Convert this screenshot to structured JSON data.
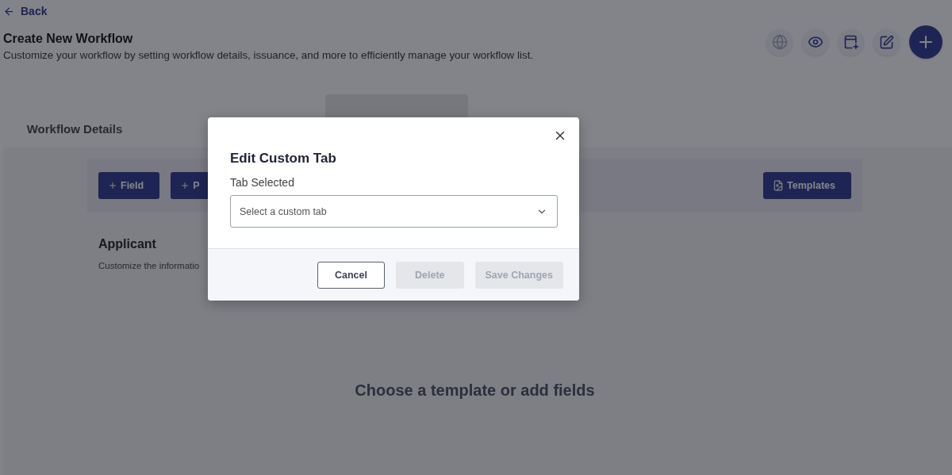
{
  "back_link": "Back",
  "header": {
    "title": "Create New Workflow",
    "subtitle": "Customize your workflow by setting workflow details, issuance, and more to efficiently manage your workflow list."
  },
  "header_actions": [
    {
      "kind": "globe",
      "disabled": true
    },
    {
      "kind": "preview",
      "disabled": false
    },
    {
      "kind": "addwindow",
      "disabled": false
    },
    {
      "kind": "edit",
      "disabled": false
    },
    {
      "kind": "add",
      "disabled": false
    }
  ],
  "tabs": [
    {
      "label": "Workflow Details",
      "selected": false
    },
    {
      "selected": true
    }
  ],
  "toolbar": {
    "buttons": [
      {
        "label": "Field"
      },
      {
        "label": "P"
      }
    ],
    "templates_button": "Templates"
  },
  "section": {
    "title": "Applicant",
    "description": "Customize the informatio"
  },
  "empty_state": "Choose a template or add fields",
  "modal": {
    "title": "Edit Custom Tab",
    "field_label": "Tab Selected",
    "select_placeholder": "Select a custom tab",
    "buttons": [
      {
        "label": "Cancel",
        "disabled": false
      },
      {
        "label": "Delete",
        "disabled": true
      },
      {
        "label": "Save Changes",
        "disabled": true
      }
    ]
  }
}
